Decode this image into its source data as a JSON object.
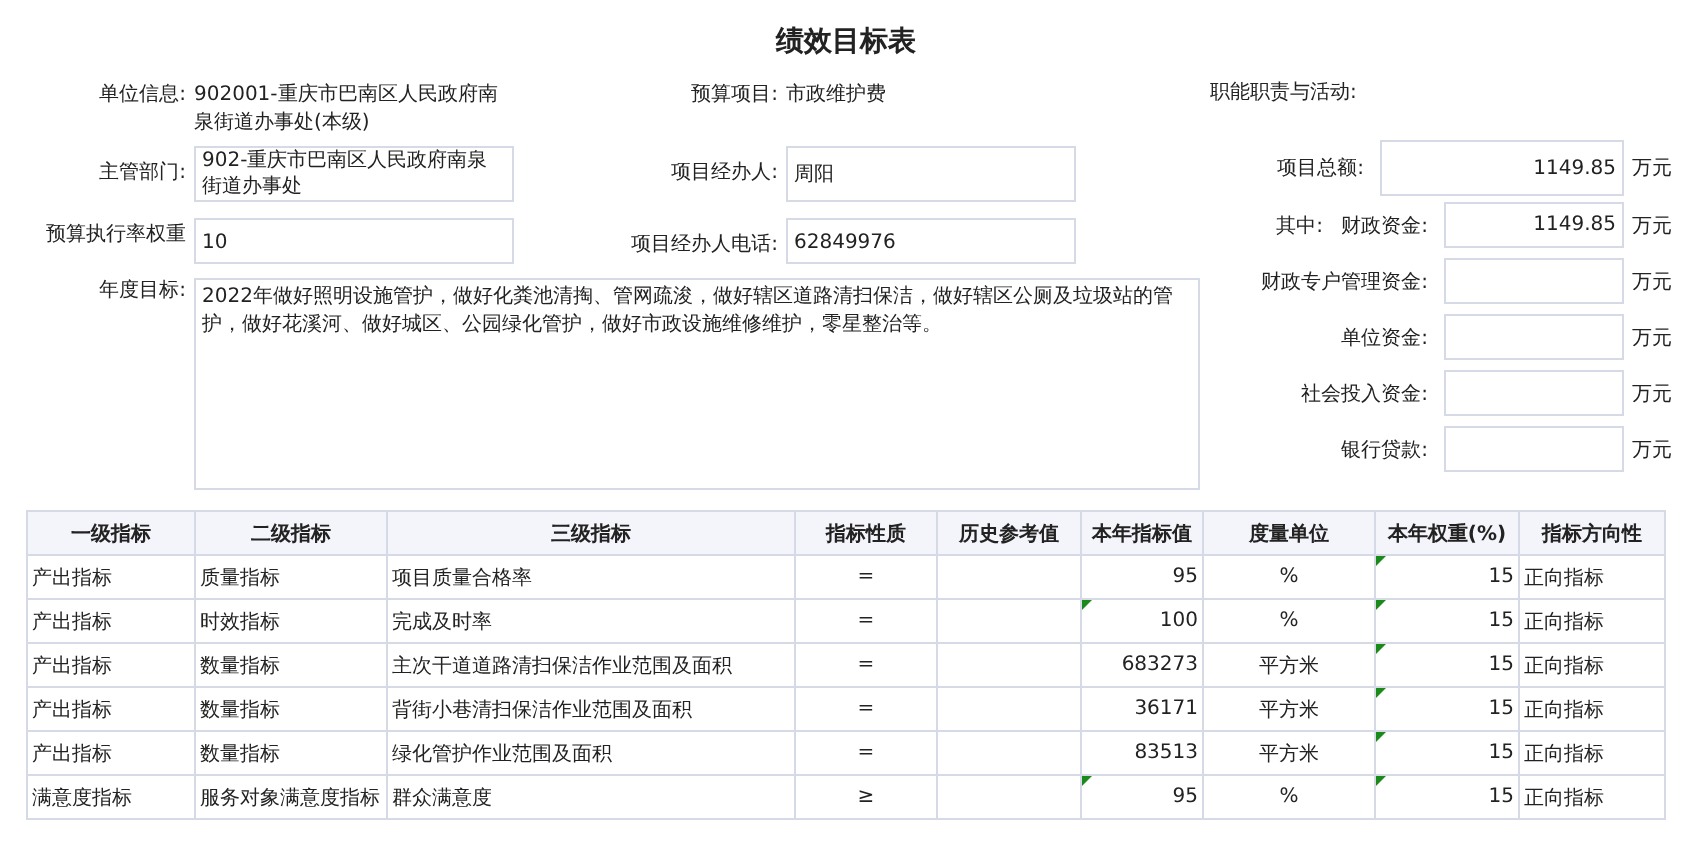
{
  "title": "绩效目标表",
  "info": {
    "unit": {
      "label": "单位信息:",
      "value": "902001-重庆市巴南区人民政府南泉街道办事处(本级)"
    },
    "budget_project": {
      "label": "预算项目:",
      "value": "市政维护费"
    },
    "function_label": "职能职责与活动:",
    "department": {
      "label": "主管部门:",
      "value": "902-重庆市巴南区人民政府南泉街道办事处"
    },
    "manager": {
      "label": "项目经办人:",
      "value": "周阳"
    },
    "exec_rate": {
      "label": "预算执行率权重",
      "value": "10"
    },
    "phone": {
      "label": "项目经办人电话:",
      "value": "62849976"
    },
    "annual_goal": {
      "label": "年度目标:",
      "value": "2022年做好照明设施管护，做好化粪池清掏、管网疏浚，做好辖区道路清扫保洁，做好辖区公厕及垃圾站的管护，做好花溪河、做好城区、公园绿化管护，做好市政设施维修维护，零星整治等。"
    }
  },
  "funds": [
    {
      "label": "项目总额:",
      "value": "1149.85",
      "unit": "万元"
    },
    {
      "prefix": "其中:",
      "label": "财政资金:",
      "value": "1149.85",
      "unit": "万元"
    },
    {
      "label": "财政专户管理资金:",
      "unit": "万元"
    },
    {
      "label": "单位资金:",
      "unit": "万元"
    },
    {
      "label": "社会投入资金:",
      "unit": "万元"
    },
    {
      "label": "银行贷款:",
      "unit": "万元"
    }
  ],
  "table": {
    "columns": [
      "一级指标",
      "二级指标",
      "三级指标",
      "指标性质",
      "历史参考值",
      "本年指标值",
      "度量单位",
      "本年权重(%)",
      "指标方向性"
    ],
    "rows": [
      {
        "level1": "产出指标",
        "level2": "质量指标",
        "level3": "项目质量合格率",
        "nature": "=",
        "value": "95",
        "value_flag": false,
        "unit": "%",
        "weight": "15",
        "weight_flag": true,
        "direction": "正向指标"
      },
      {
        "level1": "产出指标",
        "level2": "时效指标",
        "level3": "完成及时率",
        "nature": "=",
        "value": "100",
        "value_flag": true,
        "unit": "%",
        "weight": "15",
        "weight_flag": true,
        "direction": "正向指标"
      },
      {
        "level1": "产出指标",
        "level2": "数量指标",
        "level3": "主次干道道路清扫保洁作业范围及面积",
        "nature": "=",
        "value": "683273",
        "value_flag": false,
        "unit": "平方米",
        "weight": "15",
        "weight_flag": true,
        "direction": "正向指标"
      },
      {
        "level1": "产出指标",
        "level2": "数量指标",
        "level3": "背街小巷清扫保洁作业范围及面积",
        "nature": "=",
        "value": "36171",
        "value_flag": false,
        "unit": "平方米",
        "weight": "15",
        "weight_flag": true,
        "direction": "正向指标"
      },
      {
        "level1": "产出指标",
        "level2": "数量指标",
        "level3": "绿化管护作业范围及面积",
        "nature": "=",
        "value": "83513",
        "value_flag": false,
        "unit": "平方米",
        "weight": "15",
        "weight_flag": true,
        "direction": "正向指标"
      },
      {
        "level1": "满意度指标",
        "level2": "服务对象满意度指标",
        "level3": "群众满意度",
        "nature": "≥",
        "value": "95",
        "value_flag": true,
        "unit": "%",
        "weight": "15",
        "weight_flag": true,
        "direction": "正向指标"
      }
    ]
  }
}
